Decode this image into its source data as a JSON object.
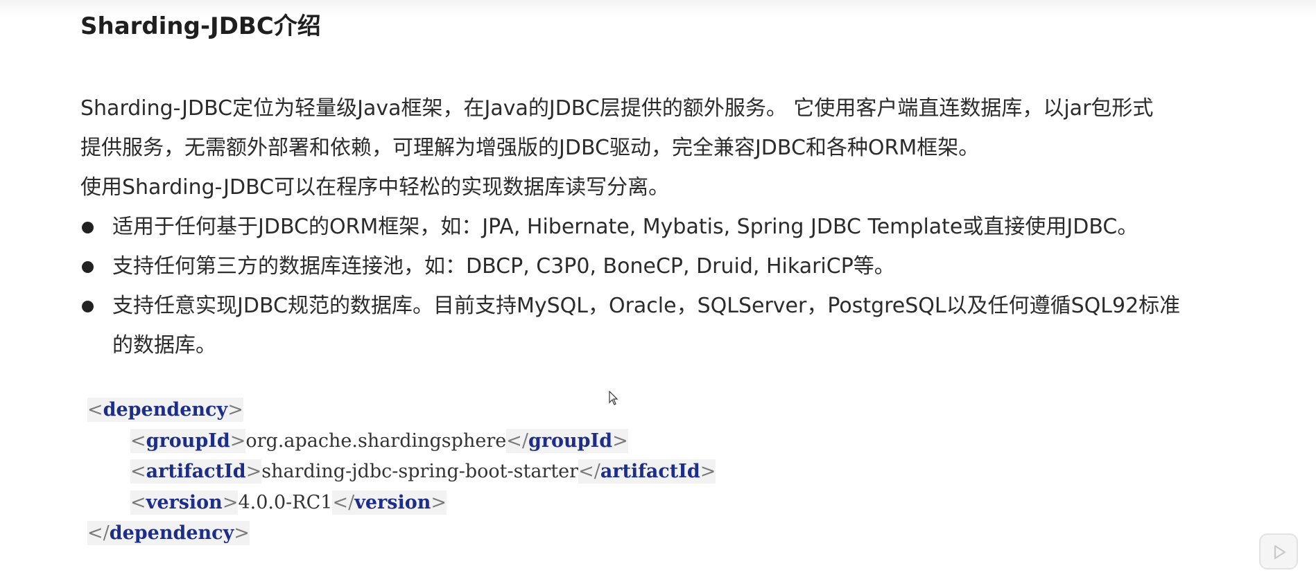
{
  "title": "Sharding-JDBC介绍",
  "intro": [
    "Sharding-JDBC定位为轻量级Java框架，在Java的JDBC层提供的额外服务。 它使用客户端直连数据库，以jar包形式",
    "提供服务，无需额外部署和依赖，可理解为增强版的JDBC驱动，完全兼容JDBC和各种ORM框架。"
  ],
  "usage": "使用Sharding-JDBC可以在程序中轻松的实现数据库读写分离。",
  "bullets": [
    "适用于任何基于JDBC的ORM框架，如：JPA, Hibernate, Mybatis, Spring JDBC Template或直接使用JDBC。",
    "支持任何第三方的数据库连接池，如：DBCP, C3P0, BoneCP, Druid, HikariCP等。",
    "支持任意实现JDBC规范的数据库。目前支持MySQL，Oracle，SQLServer，PostgreSQL以及任何遵循SQL92标准",
    "的数据库。"
  ],
  "code": {
    "dependency_tag": "dependency",
    "group_tag": "groupId",
    "group_value": "org.apache.shardingsphere",
    "artifact_tag": "artifactId",
    "artifact_value": "sharding-jdbc-spring-boot-starter",
    "version_tag": "version",
    "version_value": "4.0.0-RC1"
  },
  "icons": {
    "cursor": "mouse-pointer-icon",
    "play": "play-icon"
  }
}
